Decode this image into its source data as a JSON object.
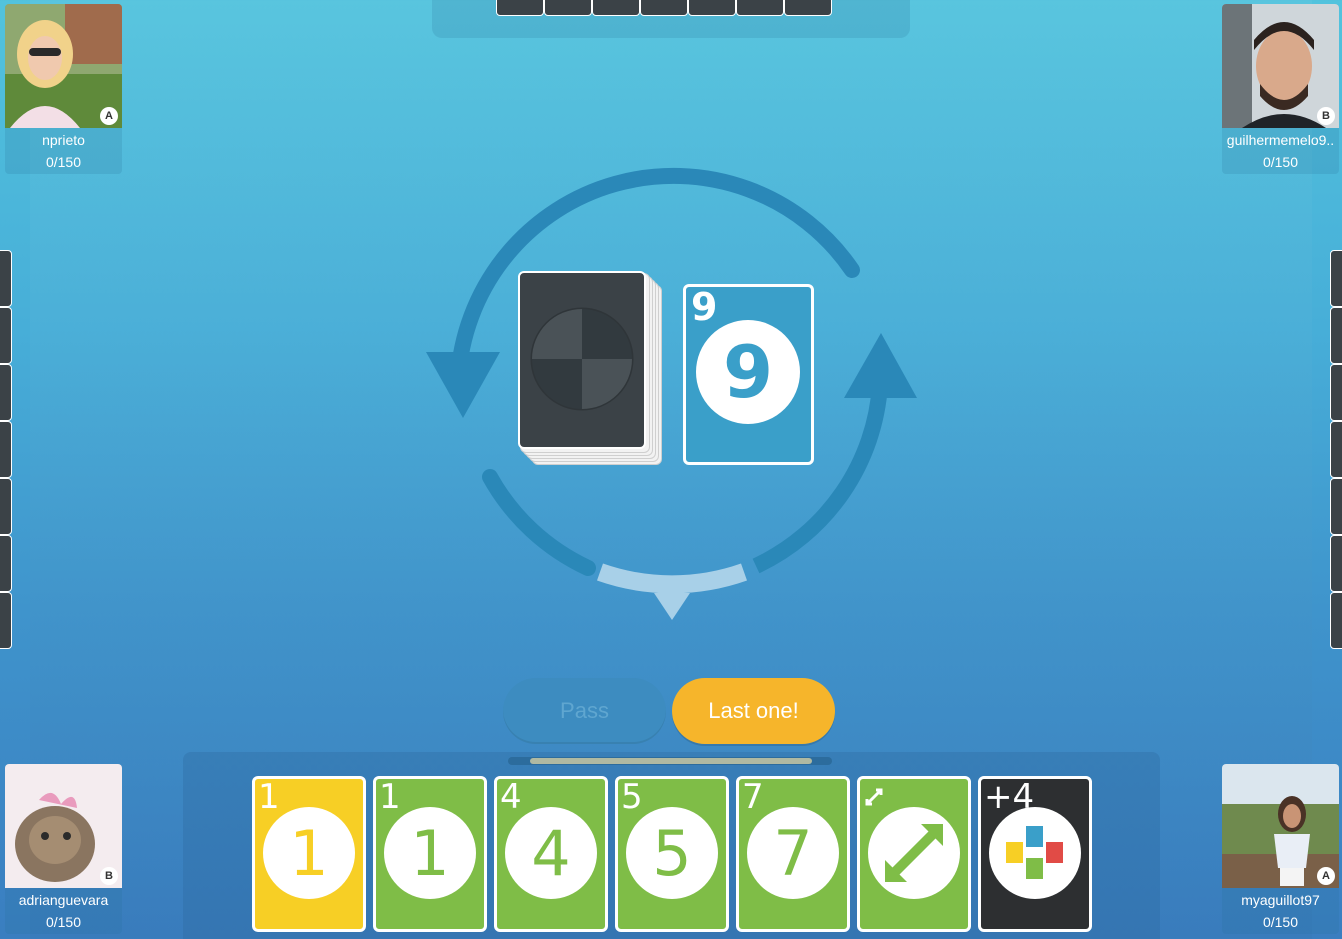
{
  "game": {
    "deck_label": "Draw pile",
    "discard": {
      "corner": "9",
      "value": "9",
      "color": "#3a9fc9"
    }
  },
  "players": {
    "top_left": {
      "name": "nprieto",
      "score": "0/150",
      "team": "A"
    },
    "top_right": {
      "name": "guilhermemelo9..",
      "score": "0/150",
      "team": "B"
    },
    "bottom_left": {
      "name": "adrianguevara",
      "score": "0/150",
      "team": "B"
    },
    "bottom_right": {
      "name": "myaguillot97",
      "score": "0/150",
      "team": "A"
    }
  },
  "opponents": {
    "top_card_count": 7,
    "left_card_count": 7,
    "right_card_count": 7
  },
  "buttons": {
    "pass": "Pass",
    "last_one": "Last one!"
  },
  "timer": {
    "remaining_fraction": 0.88
  },
  "hand": [
    {
      "corner": "1",
      "value": "1",
      "color": "yellow"
    },
    {
      "corner": "1",
      "value": "1",
      "color": "green"
    },
    {
      "corner": "4",
      "value": "4",
      "color": "green"
    },
    {
      "corner": "5",
      "value": "5",
      "color": "green"
    },
    {
      "corner": "7",
      "value": "7",
      "color": "green"
    },
    {
      "corner": "",
      "value": "",
      "color": "green",
      "icon": "reverse-icon"
    },
    {
      "corner": "+4",
      "value": "",
      "color": "black",
      "icon": "wild-draw-four-icon"
    }
  ],
  "colors": {
    "green": "#7fbd47",
    "yellow": "#f7cf25",
    "blue": "#3a9fc9",
    "orange": "#f6b52b",
    "dark": "#3b4247"
  }
}
